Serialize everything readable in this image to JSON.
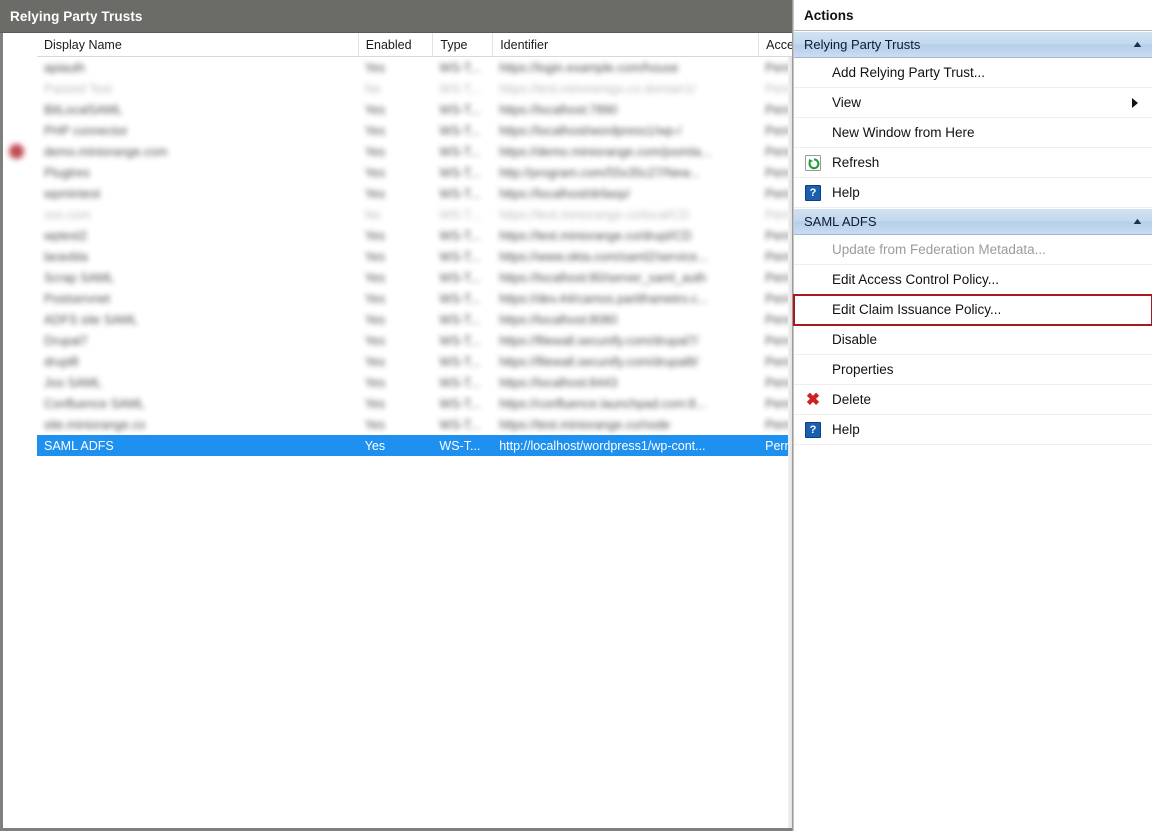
{
  "window": {
    "pane_title": "Relying Party Trusts"
  },
  "list": {
    "columns": [
      {
        "key": "display_name",
        "label": "Display Name"
      },
      {
        "key": "enabled",
        "label": "Enabled"
      },
      {
        "key": "type",
        "label": "Type"
      },
      {
        "key": "identifier",
        "label": "Identifier"
      },
      {
        "key": "access",
        "label": "Acce"
      }
    ],
    "redacted_rows": [
      {
        "display_name": "apiauth",
        "enabled": "Yes",
        "type": "WS-T...",
        "identifier": "https://login.example.com/house",
        "access": "Perm",
        "dim": false,
        "marker": false
      },
      {
        "display_name": "Passed  Test",
        "enabled": "No",
        "type": "WS-T...",
        "identifier": "https://test.mimmimigo.co.domain1/",
        "access": "Perm",
        "dim": true,
        "marker": false
      },
      {
        "display_name": "BitLocalSAML",
        "enabled": "Yes",
        "type": "WS-T...",
        "identifier": "https://localhost:7890",
        "access": "Perm",
        "dim": false,
        "marker": false
      },
      {
        "display_name": "PHP connector",
        "enabled": "Yes",
        "type": "WS-T...",
        "identifier": "https://localhost/wordpress1/wp-/",
        "access": "Perm",
        "dim": false,
        "marker": false
      },
      {
        "display_name": "demo.miniorange.com",
        "enabled": "Yes",
        "type": "WS-T...",
        "identifier": "https://demo.miniorange.com/joomla...",
        "access": "Perm",
        "dim": false,
        "marker": true
      },
      {
        "display_name": "Plugtres",
        "enabled": "Yes",
        "type": "WS-T...",
        "identifier": "http://program.com/55x35c27/New...",
        "access": "Perm",
        "dim": false,
        "marker": false
      },
      {
        "display_name": "wpmintest",
        "enabled": "Yes",
        "type": "WS-T...",
        "identifier": "https://localhost/drilasp/",
        "access": "Perm",
        "dim": false,
        "marker": false
      },
      {
        "display_name": "sso.com",
        "enabled": "No",
        "type": "WS-T...",
        "identifier": "https://test.miniorange.co/local/CD",
        "access": "Perm",
        "dim": true,
        "marker": false
      },
      {
        "display_name": "wptest2",
        "enabled": "Yes",
        "type": "WS-T...",
        "identifier": "https://test.miniorange.co/drupl/CD",
        "access": "Perm",
        "dim": false,
        "marker": false
      },
      {
        "display_name": "laravbla",
        "enabled": "Yes",
        "type": "WS-T...",
        "identifier": "https://www.okta.com/saml2/service...",
        "access": "Perm",
        "dim": false,
        "marker": false
      },
      {
        "display_name": "Scrap SAML",
        "enabled": "Yes",
        "type": "WS-T...",
        "identifier": "https://localhost:80/server_saml_auth",
        "access": "Perm",
        "dim": false,
        "marker": false
      },
      {
        "display_name": "Postservnet",
        "enabled": "Yes",
        "type": "WS-T...",
        "identifier": "https://dev.44/camos.partiframetro.c...",
        "access": "Perm",
        "dim": false,
        "marker": false
      },
      {
        "display_name": "ADFS site SAML",
        "enabled": "Yes",
        "type": "WS-T...",
        "identifier": "https://localhost:8080",
        "access": "Perm",
        "dim": false,
        "marker": false
      },
      {
        "display_name": "Drupal7",
        "enabled": "Yes",
        "type": "WS-T...",
        "identifier": "https://filewall.secunify.com/drupal7/",
        "access": "Perm",
        "dim": false,
        "marker": false
      },
      {
        "display_name": "drupl8",
        "enabled": "Yes",
        "type": "WS-T...",
        "identifier": "https://filewall.secunify.com/drupal8/",
        "access": "Perm",
        "dim": false,
        "marker": false
      },
      {
        "display_name": "Joo SAML",
        "enabled": "Yes",
        "type": "WS-T...",
        "identifier": "https://localhost:8443",
        "access": "Perm",
        "dim": false,
        "marker": false
      },
      {
        "display_name": "Confluence SAML",
        "enabled": "Yes",
        "type": "WS-T...",
        "identifier": "https://confluence.launchpad.com:8...",
        "access": "Perm",
        "dim": false,
        "marker": false
      },
      {
        "display_name": "site.miniorange.co",
        "enabled": "Yes",
        "type": "WS-T...",
        "identifier": "https://test.miniorange.co/node",
        "access": "Perm",
        "dim": false,
        "marker": false
      }
    ],
    "selected_row": {
      "display_name": "SAML ADFS",
      "enabled": "Yes",
      "type": "WS-T...",
      "identifier": "http://localhost/wordpress1/wp-cont...",
      "access": "Perm"
    }
  },
  "actions": {
    "title": "Actions",
    "sections": [
      {
        "header": "Relying Party Trusts",
        "collapse_glyph": "▲",
        "items": [
          {
            "label": "Add Relying Party Trust...",
            "icon": "none",
            "disabled": false,
            "submenu": false,
            "highlight": false
          },
          {
            "label": "View",
            "icon": "none",
            "disabled": false,
            "submenu": true,
            "highlight": false
          },
          {
            "label": "New Window from Here",
            "icon": "none",
            "disabled": false,
            "submenu": false,
            "highlight": false
          },
          {
            "label": "Refresh",
            "icon": "refresh",
            "disabled": false,
            "submenu": false,
            "highlight": false
          },
          {
            "label": "Help",
            "icon": "help",
            "disabled": false,
            "submenu": false,
            "highlight": false
          }
        ]
      },
      {
        "header": "SAML ADFS",
        "collapse_glyph": "▲",
        "items": [
          {
            "label": "Update from Federation Metadata...",
            "icon": "none",
            "disabled": true,
            "submenu": false,
            "highlight": false
          },
          {
            "label": "Edit Access Control Policy...",
            "icon": "none",
            "disabled": false,
            "submenu": false,
            "highlight": false
          },
          {
            "label": "Edit Claim Issuance Policy...",
            "icon": "none",
            "disabled": false,
            "submenu": false,
            "highlight": true
          },
          {
            "label": "Disable",
            "icon": "none",
            "disabled": false,
            "submenu": false,
            "highlight": false
          },
          {
            "label": "Properties",
            "icon": "none",
            "disabled": false,
            "submenu": false,
            "highlight": false
          },
          {
            "label": "Delete",
            "icon": "delete",
            "disabled": false,
            "submenu": false,
            "highlight": false
          },
          {
            "label": "Help",
            "icon": "help",
            "disabled": false,
            "submenu": false,
            "highlight": false
          }
        ]
      }
    ],
    "help_glyph": "?",
    "delete_glyph": "✖"
  },
  "colors": {
    "title_bar": "#6b6b67",
    "selection": "#1e90ef",
    "section_header": "#c3d8ef",
    "highlight_outline": "#a6191f",
    "help_icon": "#1b5fae",
    "delete_icon": "#cc2222",
    "refresh_icon": "#1f9d3a"
  }
}
